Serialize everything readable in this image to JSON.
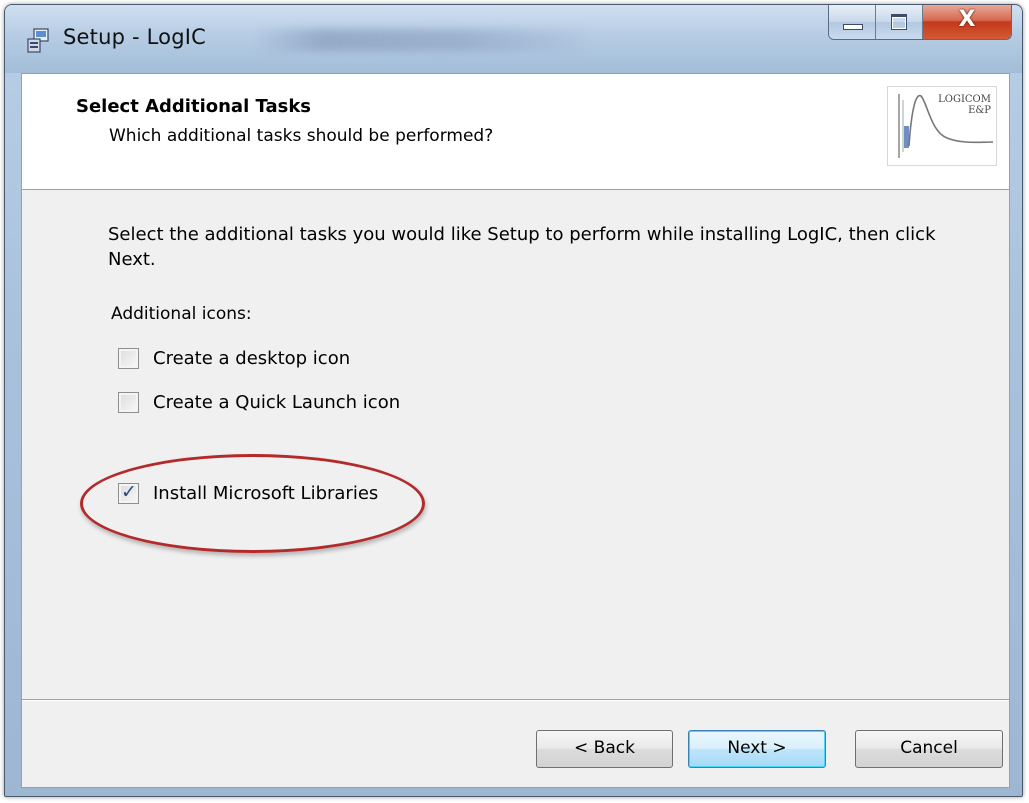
{
  "window": {
    "title": "Setup - LogIC",
    "close_glyph": "X"
  },
  "header": {
    "title": "Select Additional Tasks",
    "subtitle": "Which additional tasks should be performed?",
    "logo_text_line1": "LOGICOM",
    "logo_text_line2": "E&P"
  },
  "body": {
    "instructions": "Select the additional tasks you would like Setup to perform while installing LogIC, then click Next.",
    "section_label": "Additional icons:",
    "tasks": [
      {
        "label": "Create a desktop icon",
        "checked": false
      },
      {
        "label": "Create a Quick Launch icon",
        "checked": false
      },
      {
        "label": "Install Microsoft Libraries",
        "checked": true
      }
    ],
    "check_glyph": "✓"
  },
  "buttons": {
    "back": "< Back",
    "next": "Next >",
    "cancel": "Cancel"
  },
  "colors": {
    "annotation_ellipse": "#b32a2a",
    "default_button_border": "#3c7fb1"
  }
}
